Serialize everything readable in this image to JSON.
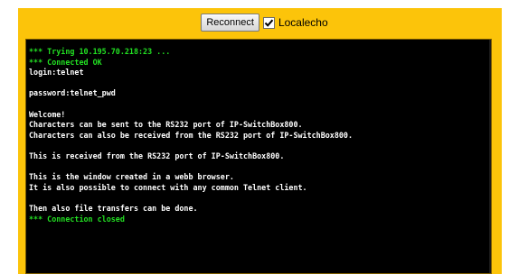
{
  "toolbar": {
    "reconnect_label": "Reconnect",
    "localecho_label": "Localecho",
    "localecho_checked": true
  },
  "terminal": {
    "lines": [
      {
        "text": "*** Trying 10.195.70.218:23 ...",
        "color": "green"
      },
      {
        "text": "*** Connected OK",
        "color": "green"
      },
      {
        "text": "login:telnet",
        "color": "white"
      },
      {
        "text": "",
        "color": "white"
      },
      {
        "text": "password:telnet_pwd",
        "color": "white"
      },
      {
        "text": "",
        "color": "white"
      },
      {
        "text": "Welcome!",
        "color": "white"
      },
      {
        "text": "Characters can be sent to the RS232 port of IP-SwitchBox800.",
        "color": "white"
      },
      {
        "text": "Characters can also be received from the RS232 port of IP-SwitchBox800.",
        "color": "white"
      },
      {
        "text": "",
        "color": "white"
      },
      {
        "text": "This is received from the RS232 port of IP-SwitchBox800.",
        "color": "white"
      },
      {
        "text": "",
        "color": "white"
      },
      {
        "text": "This is the window created in a webb browser.",
        "color": "white"
      },
      {
        "text": "It is also possible to connect with any common Telnet client.",
        "color": "white"
      },
      {
        "text": "",
        "color": "white"
      },
      {
        "text": "Then also file transfers can be done.",
        "color": "white"
      },
      {
        "text": "*** Connection closed",
        "color": "green"
      }
    ]
  },
  "colors": {
    "frame": "#fcc40a",
    "terminal_bg": "#000000",
    "text_white": "#ffffff",
    "text_green": "#22e022"
  }
}
